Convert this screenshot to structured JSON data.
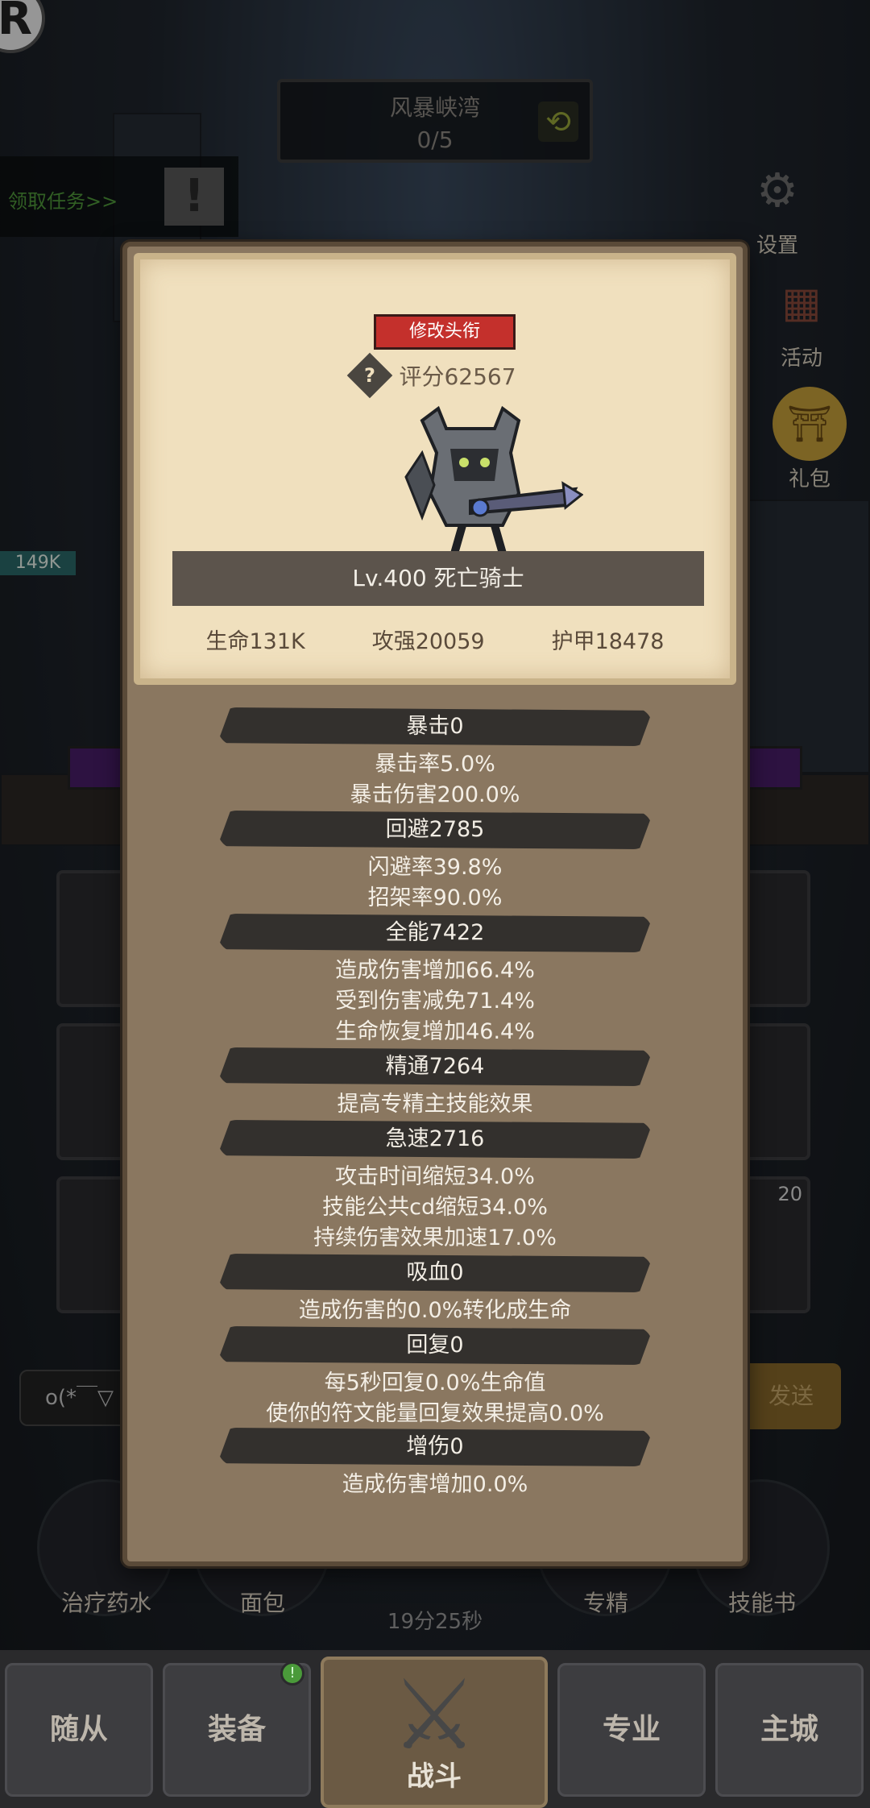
{
  "top": {
    "logo_letter": "R",
    "zone_name": "风暴峡湾",
    "zone_progress": "0/5",
    "quest_label": "领取任务>>",
    "quest_alert": "!"
  },
  "side_menu": [
    {
      "label": "设置",
      "icon": "gear-icon"
    },
    {
      "label": "活动",
      "icon": "calendar-icon"
    },
    {
      "label": "礼包",
      "icon": "gift-icon"
    }
  ],
  "left_hp": "149K",
  "skill_slot_count": "20",
  "chat": {
    "input_text": "o(*￣▽",
    "send_label": "发送"
  },
  "consumables": [
    {
      "label": "治疗药水"
    },
    {
      "label": "面包"
    },
    {
      "label": "专精"
    },
    {
      "label": "技能书"
    }
  ],
  "timer": "19分25秒",
  "nav": {
    "tabs": [
      "随从",
      "装备",
      "战斗",
      "专业",
      "主城"
    ],
    "badge": "!"
  },
  "modal": {
    "edit_title_button": "修改头衔",
    "score_label": "评分62567",
    "character_name": "Lv.400 死亡骑士",
    "stats": [
      "生命131K",
      "攻强20059",
      "护甲18478"
    ],
    "attributes": [
      {
        "head": "暴击0",
        "lines": [
          "暴击率5.0%",
          "暴击伤害200.0%"
        ]
      },
      {
        "head": "回避2785",
        "lines": [
          "闪避率39.8%",
          "招架率90.0%"
        ]
      },
      {
        "head": "全能7422",
        "lines": [
          "造成伤害增加66.4%",
          "受到伤害减免71.4%",
          "生命恢复增加46.4%"
        ]
      },
      {
        "head": "精通7264",
        "lines": [
          "提高专精主技能效果"
        ]
      },
      {
        "head": "急速2716",
        "lines": [
          "攻击时间缩短34.0%",
          "技能公共cd缩短34.0%",
          "持续伤害效果加速17.0%"
        ]
      },
      {
        "head": "吸血0",
        "lines": [
          "造成伤害的0.0%转化成生命"
        ]
      },
      {
        "head": "回复0",
        "lines": [
          "每5秒回复0.0%生命值",
          "使你的符文能量回复效果提高0.0%"
        ]
      },
      {
        "head": "增伤0",
        "lines": [
          "造成伤害增加0.0%"
        ]
      }
    ]
  }
}
